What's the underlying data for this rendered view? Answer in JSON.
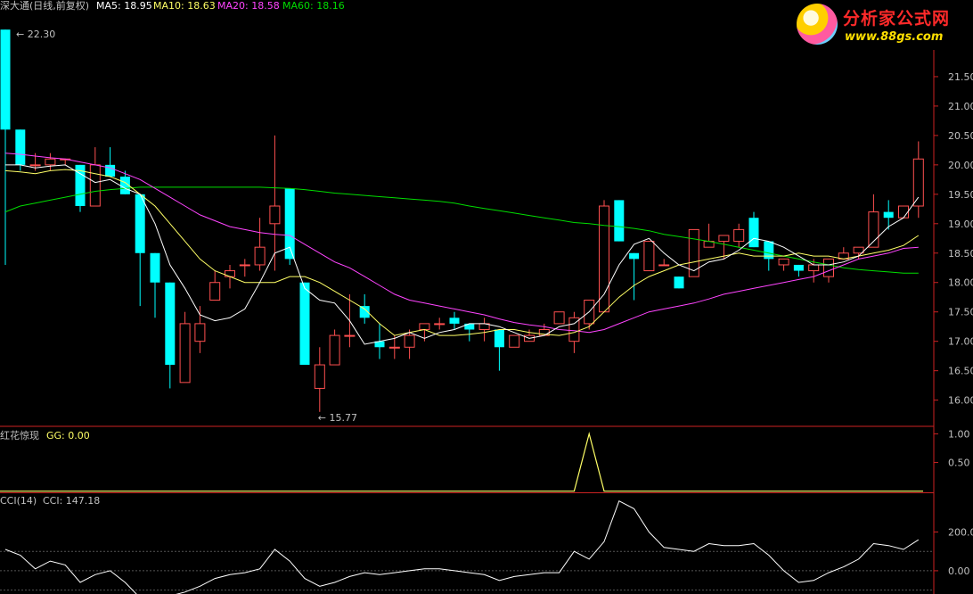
{
  "header": {
    "title": "深大通(日线,前复权)",
    "ma5": "MA5: 18.95",
    "ma10": "MA10: 18.63",
    "ma20": "MA20: 18.58",
    "ma60": "MA60: 18.16",
    "high_marker": "22.30",
    "low_marker": "15.77"
  },
  "indicator1": {
    "name": "红花惊现",
    "value": "GG: 0.00"
  },
  "indicator2": {
    "name": "CCI(14)",
    "value": "CCI: 147.18"
  },
  "logo": {
    "text": "分析家公式网",
    "url": "www.88gs.com"
  },
  "colors": {
    "up": "#ff5050",
    "down": "#00ffff",
    "ma5": "#ffffff",
    "ma10": "#ffff66",
    "ma20": "#ff44ff",
    "ma60": "#00dd00",
    "axis": "#cc2222",
    "text": "#c0c0c0"
  },
  "chart_data": [
    {
      "type": "candlestick",
      "title": "深大通(日线,前复权)",
      "y_ticks": [
        "16.00",
        "16.50",
        "17.00",
        "17.50",
        "18.00",
        "18.50",
        "19.00",
        "19.50",
        "20.00",
        "20.50",
        "21.00",
        "21.50"
      ],
      "ylim": [
        15.6,
        22.5
      ],
      "candles": [
        [
          22.3,
          22.3,
          18.3,
          20.6
        ],
        [
          20.6,
          20.6,
          19.9,
          20.0
        ],
        [
          20.0,
          20.2,
          19.9,
          20.0
        ],
        [
          20.0,
          20.2,
          19.9,
          20.1
        ],
        [
          20.1,
          20.1,
          20.0,
          20.1
        ],
        [
          20.0,
          20.0,
          19.2,
          19.3
        ],
        [
          19.3,
          20.3,
          19.3,
          20.0
        ],
        [
          20.0,
          20.3,
          19.8,
          19.8
        ],
        [
          19.8,
          19.9,
          19.5,
          19.5
        ],
        [
          19.5,
          19.5,
          17.6,
          18.5
        ],
        [
          18.5,
          18.5,
          17.4,
          18.0
        ],
        [
          18.0,
          18.0,
          16.2,
          16.6
        ],
        [
          16.3,
          17.5,
          16.3,
          17.3
        ],
        [
          17.0,
          17.6,
          16.8,
          17.3
        ],
        [
          17.7,
          18.2,
          17.7,
          18.0
        ],
        [
          18.1,
          18.3,
          17.9,
          18.2
        ],
        [
          18.3,
          18.4,
          18.1,
          18.3
        ],
        [
          18.3,
          19.1,
          18.2,
          18.6
        ],
        [
          19.0,
          20.5,
          18.2,
          19.3
        ],
        [
          19.6,
          19.6,
          18.3,
          18.4
        ],
        [
          18.0,
          18.0,
          16.6,
          16.6
        ],
        [
          16.2,
          16.9,
          15.8,
          16.6
        ],
        [
          16.6,
          17.2,
          16.6,
          17.1
        ],
        [
          17.1,
          17.8,
          16.9,
          17.1
        ],
        [
          17.6,
          17.8,
          17.3,
          17.4
        ],
        [
          17.0,
          17.3,
          16.7,
          16.9
        ],
        [
          16.9,
          17.1,
          16.7,
          16.9
        ],
        [
          16.9,
          17.2,
          16.7,
          17.1
        ],
        [
          17.2,
          17.3,
          17.0,
          17.3
        ],
        [
          17.3,
          17.4,
          17.2,
          17.3
        ],
        [
          17.4,
          17.5,
          17.2,
          17.3
        ],
        [
          17.3,
          17.3,
          17.0,
          17.2
        ],
        [
          17.2,
          17.4,
          17.0,
          17.3
        ],
        [
          17.2,
          17.2,
          16.5,
          16.9
        ],
        [
          16.9,
          17.1,
          16.9,
          17.1
        ],
        [
          17.0,
          17.2,
          17.0,
          17.1
        ],
        [
          17.1,
          17.3,
          17.1,
          17.2
        ],
        [
          17.3,
          17.5,
          17.3,
          17.5
        ],
        [
          17.0,
          17.5,
          16.8,
          17.4
        ],
        [
          17.3,
          17.7,
          17.2,
          17.7
        ],
        [
          17.5,
          19.4,
          17.5,
          19.3
        ],
        [
          19.4,
          19.4,
          18.7,
          18.7
        ],
        [
          18.5,
          18.5,
          17.7,
          18.4
        ],
        [
          18.2,
          18.7,
          18.2,
          18.7
        ],
        [
          18.3,
          18.4,
          18.3,
          18.3
        ],
        [
          18.1,
          18.1,
          17.9,
          17.9
        ],
        [
          18.1,
          18.9,
          18.1,
          18.9
        ],
        [
          18.6,
          19.0,
          18.6,
          18.7
        ],
        [
          18.7,
          18.8,
          18.4,
          18.8
        ],
        [
          18.7,
          19.0,
          18.6,
          18.9
        ],
        [
          19.1,
          19.2,
          18.6,
          18.6
        ],
        [
          18.7,
          18.7,
          18.2,
          18.4
        ],
        [
          18.3,
          18.4,
          18.2,
          18.4
        ],
        [
          18.3,
          18.3,
          18.1,
          18.2
        ],
        [
          18.2,
          18.4,
          18.0,
          18.3
        ],
        [
          18.1,
          18.4,
          18.0,
          18.4
        ],
        [
          18.4,
          18.6,
          18.4,
          18.5
        ],
        [
          18.5,
          18.6,
          18.4,
          18.6
        ],
        [
          18.6,
          19.5,
          18.6,
          19.2
        ],
        [
          19.2,
          19.4,
          18.9,
          19.1
        ],
        [
          19.1,
          19.3,
          19.1,
          19.3
        ],
        [
          19.3,
          20.4,
          19.1,
          20.1
        ]
      ],
      "ma5": [
        20.0,
        20.0,
        19.95,
        19.98,
        20.0,
        19.85,
        19.7,
        19.75,
        19.6,
        19.5,
        19.0,
        18.3,
        17.9,
        17.45,
        17.35,
        17.4,
        17.55,
        18.0,
        18.5,
        18.6,
        17.9,
        17.7,
        17.65,
        17.35,
        16.95,
        17.0,
        17.05,
        17.15,
        17.05,
        17.15,
        17.2,
        17.3,
        17.3,
        17.25,
        17.15,
        17.05,
        17.1,
        17.25,
        17.3,
        17.5,
        17.8,
        18.3,
        18.65,
        18.75,
        18.5,
        18.3,
        18.2,
        18.35,
        18.4,
        18.55,
        18.75,
        18.7,
        18.6,
        18.45,
        18.3,
        18.3,
        18.35,
        18.45,
        18.7,
        18.95,
        19.1,
        19.45
      ],
      "ma10": [
        19.9,
        19.88,
        19.85,
        19.9,
        19.92,
        19.9,
        19.85,
        19.8,
        19.7,
        19.5,
        19.3,
        19.0,
        18.7,
        18.4,
        18.2,
        18.1,
        18.0,
        18.0,
        18.0,
        18.1,
        18.1,
        18.0,
        17.85,
        17.7,
        17.55,
        17.3,
        17.1,
        17.15,
        17.2,
        17.1,
        17.1,
        17.12,
        17.15,
        17.2,
        17.2,
        17.15,
        17.12,
        17.1,
        17.15,
        17.25,
        17.5,
        17.75,
        17.95,
        18.1,
        18.2,
        18.3,
        18.35,
        18.4,
        18.45,
        18.5,
        18.45,
        18.45,
        18.45,
        18.5,
        18.45,
        18.45,
        18.4,
        18.45,
        18.5,
        18.55,
        18.63,
        18.8
      ],
      "ma20": [
        20.2,
        20.18,
        20.15,
        20.12,
        20.1,
        20.05,
        20.0,
        19.95,
        19.85,
        19.75,
        19.6,
        19.45,
        19.3,
        19.15,
        19.05,
        18.95,
        18.9,
        18.85,
        18.82,
        18.8,
        18.65,
        18.5,
        18.35,
        18.25,
        18.1,
        17.95,
        17.8,
        17.7,
        17.65,
        17.6,
        17.55,
        17.5,
        17.45,
        17.38,
        17.32,
        17.28,
        17.25,
        17.2,
        17.18,
        17.15,
        17.2,
        17.3,
        17.4,
        17.5,
        17.55,
        17.6,
        17.65,
        17.72,
        17.8,
        17.85,
        17.9,
        17.95,
        18.0,
        18.05,
        18.1,
        18.2,
        18.3,
        18.4,
        18.45,
        18.5,
        18.58,
        18.6
      ],
      "ma60": [
        19.2,
        19.3,
        19.35,
        19.4,
        19.45,
        19.5,
        19.55,
        19.58,
        19.6,
        19.62,
        19.62,
        19.62,
        19.62,
        19.62,
        19.62,
        19.62,
        19.62,
        19.62,
        19.61,
        19.6,
        19.58,
        19.55,
        19.52,
        19.5,
        19.48,
        19.46,
        19.44,
        19.42,
        19.4,
        19.38,
        19.35,
        19.3,
        19.26,
        19.22,
        19.18,
        19.14,
        19.1,
        19.06,
        19.02,
        19.0,
        18.97,
        18.95,
        18.92,
        18.88,
        18.82,
        18.78,
        18.74,
        18.7,
        18.65,
        18.6,
        18.55,
        18.5,
        18.45,
        18.4,
        18.35,
        18.3,
        18.25,
        18.22,
        18.2,
        18.18,
        18.16,
        18.16
      ]
    },
    {
      "type": "line",
      "title": "红花惊现",
      "y_ticks": [
        "0.50",
        "1.00"
      ],
      "ylim": [
        0,
        1.1
      ],
      "series": [
        {
          "name": "GG",
          "values": [
            0,
            0,
            0,
            0,
            0,
            0,
            0,
            0,
            0,
            0,
            0,
            0,
            0,
            0,
            0,
            0,
            0,
            0,
            0,
            0,
            0,
            0,
            0,
            0,
            0,
            0,
            0,
            0,
            0,
            0,
            0,
            0,
            0,
            0,
            0,
            0,
            0,
            0,
            0,
            1,
            0,
            0,
            0,
            0,
            0,
            0,
            0,
            0,
            0,
            0,
            0,
            0,
            0,
            0,
            0,
            0,
            0,
            0,
            0,
            0,
            0,
            0
          ]
        }
      ]
    },
    {
      "type": "line",
      "title": "CCI(14)",
      "y_ticks": [
        "0.00",
        "200.0"
      ],
      "ylim": [
        -120,
        400
      ],
      "series": [
        {
          "name": "CCI",
          "values": [
            110,
            80,
            10,
            50,
            30,
            -60,
            -20,
            0,
            -60,
            -140,
            -150,
            -130,
            -110,
            -80,
            -40,
            -20,
            -10,
            10,
            110,
            50,
            -40,
            -80,
            -60,
            -30,
            -10,
            -20,
            -10,
            0,
            10,
            10,
            0,
            -10,
            -20,
            -50,
            -30,
            -20,
            -10,
            -10,
            100,
            60,
            150,
            360,
            320,
            200,
            120,
            110,
            100,
            140,
            130,
            130,
            140,
            80,
            0,
            -60,
            -50,
            -10,
            20,
            60,
            140,
            130,
            110,
            160
          ]
        }
      ]
    }
  ]
}
